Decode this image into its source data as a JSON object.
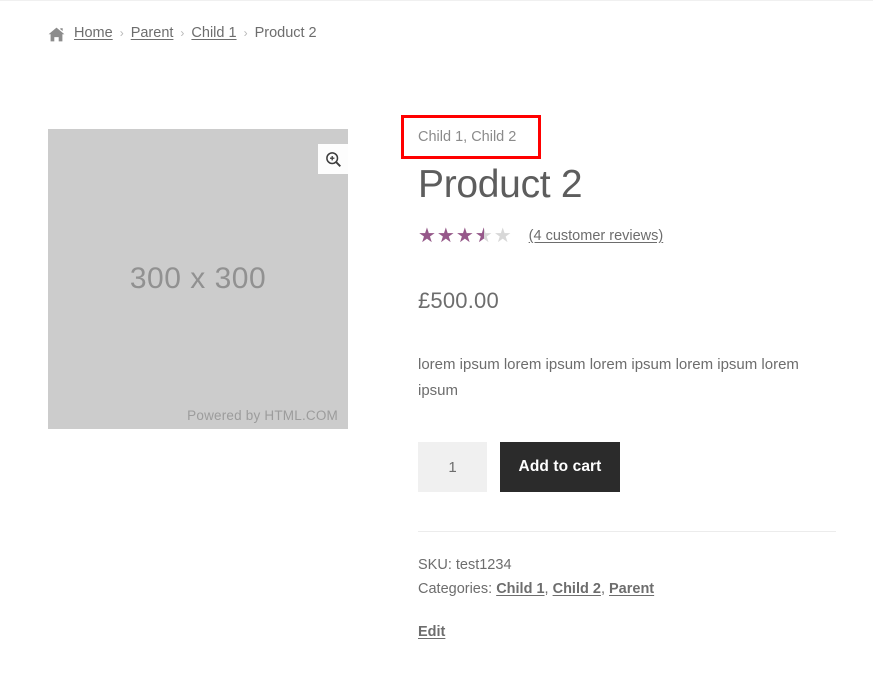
{
  "breadcrumb": {
    "home_icon": "home-icon",
    "items": [
      {
        "label": "Home",
        "link": true
      },
      {
        "label": "Parent",
        "link": true
      },
      {
        "label": "Child 1",
        "link": true
      },
      {
        "label": "Product 2",
        "link": false
      }
    ],
    "separator": "›"
  },
  "gallery": {
    "placeholder_dimensions": "300 x 300",
    "credit": "Powered by HTML.COM",
    "zoom_icon": "magnifier-plus-icon",
    "placeholder_color": "#cccccc"
  },
  "summary": {
    "categories_line": "Child 1, Child 2",
    "title": "Product 2",
    "rating": {
      "value": 3.5,
      "max": 5,
      "star_glyphs": "★★★★★",
      "filled_color": "#96588a",
      "empty_color": "#d8d8d8",
      "reviews_label": "(4 customer reviews)",
      "review_count": 4
    },
    "price": "£500.00",
    "description": "lorem ipsum lorem ipsum lorem ipsum lorem ipsum lorem ipsum",
    "cart": {
      "quantity_value": "1",
      "quantity_placeholder": "1",
      "add_to_cart_label": "Add to cart",
      "button_color": "#2b2b2b"
    },
    "meta": {
      "sku_label": "SKU:",
      "sku_value": "test1234",
      "categories_label": "Categories:",
      "categories": [
        "Child 1",
        "Child 2",
        "Parent"
      ],
      "category_separator": ", ",
      "edit_label": "Edit",
      "edit_color": "#96588a"
    }
  },
  "annotation": {
    "highlight_color": "#ff0000",
    "target": "categories_line"
  }
}
